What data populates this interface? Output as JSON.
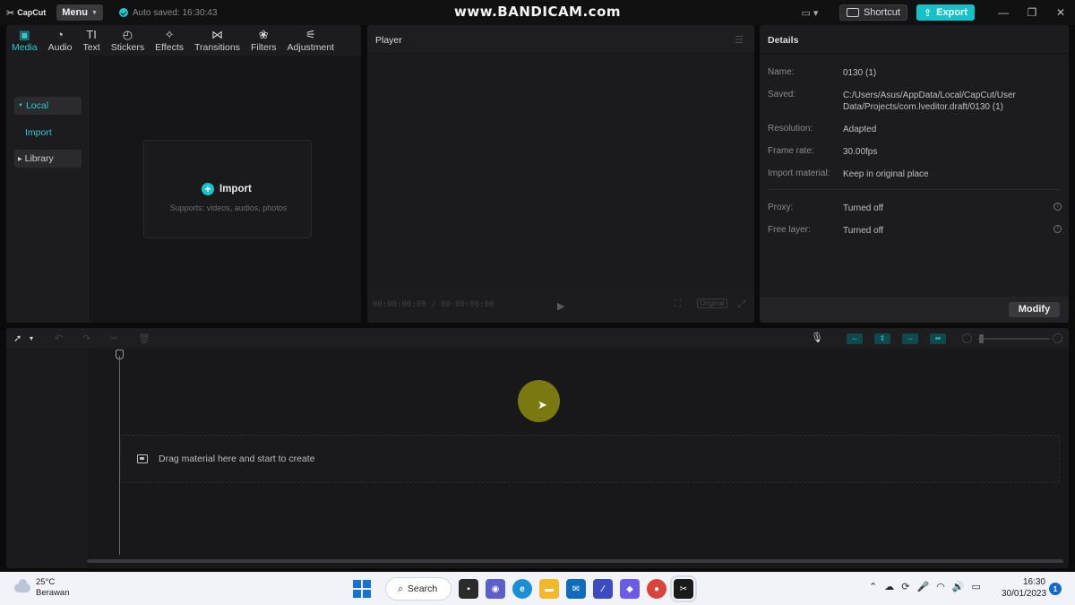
{
  "window": {
    "app_name": "CapCut",
    "menu_label": "Menu",
    "autosave_text": "Auto saved: 16:30:43",
    "watermark": "www.BANDICAM.com",
    "shortcut_label": "Shortcut",
    "export_label": "Export"
  },
  "media_panel": {
    "tabs": [
      {
        "label": "Media",
        "icon": "media-icon",
        "active": true
      },
      {
        "label": "Audio",
        "icon": "audio-icon",
        "active": false
      },
      {
        "label": "Text",
        "icon": "text-icon",
        "active": false
      },
      {
        "label": "Stickers",
        "icon": "stickers-icon",
        "active": false
      },
      {
        "label": "Effects",
        "icon": "effects-icon",
        "active": false
      },
      {
        "label": "Transitions",
        "icon": "transitions-icon",
        "active": false
      },
      {
        "label": "Filters",
        "icon": "filters-icon",
        "active": false
      },
      {
        "label": "Adjustment",
        "icon": "adjustment-icon",
        "active": false
      }
    ],
    "sidebar": {
      "local": "Local",
      "import": "Import",
      "library": "Library"
    },
    "import_box": {
      "label": "Import",
      "supports": "Supports: videos, audios, photos"
    }
  },
  "player": {
    "title": "Player",
    "timecode": "00:00:00:00 / 00:00:00:00",
    "ratio_label": "Original"
  },
  "details": {
    "title": "Details",
    "rows": [
      {
        "key": "Name:",
        "value": "0130 (1)"
      },
      {
        "key": "Saved:",
        "value": "C:/Users/Asus/AppData/Local/CapCut/User Data/Projects/com.lveditor.draft/0130 (1)"
      },
      {
        "key": "Resolution:",
        "value": "Adapted"
      },
      {
        "key": "Frame rate:",
        "value": "30.00fps"
      },
      {
        "key": "Import material:",
        "value": "Keep in original place"
      },
      {
        "key": "Proxy:",
        "value": "Turned off"
      },
      {
        "key": "Free layer:",
        "value": "Turned off"
      }
    ],
    "modify_label": "Modify"
  },
  "timeline": {
    "drop_text": "Drag material here and start to create"
  },
  "taskbar": {
    "temperature": "25°C",
    "weather": "Berawan",
    "search_label": "Search",
    "time": "16:30",
    "date": "30/01/2023",
    "notification_count": "1"
  },
  "colors": {
    "accent": "#1ac9cf",
    "panel_bg": "#1c1c1e",
    "app_bg": "#0b0b0c",
    "taskbar_bg": "#f2f3f8"
  }
}
